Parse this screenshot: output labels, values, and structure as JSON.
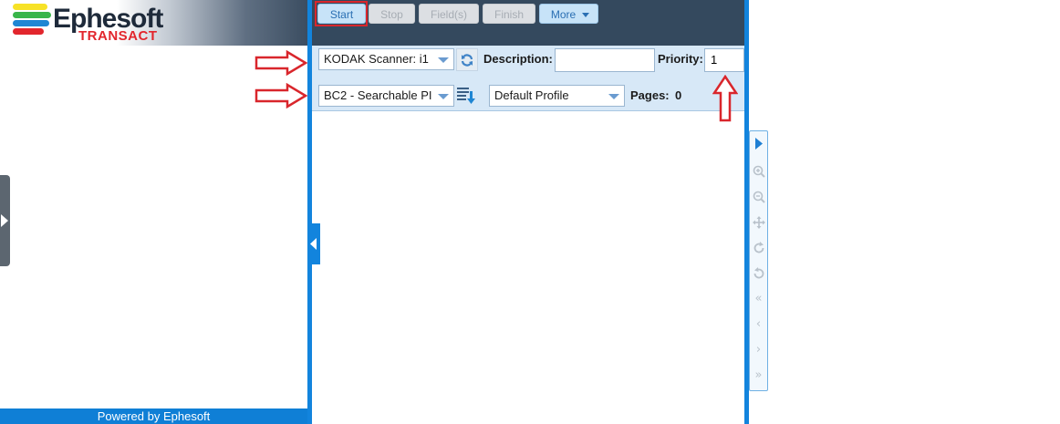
{
  "logo": {
    "name": "Ephesoft",
    "tagline": "TRANSACT"
  },
  "footer": {
    "text": "Powered by Ephesoft"
  },
  "toolbar": {
    "start": "Start",
    "stop": "Stop",
    "fields": "Field(s)",
    "finish": "Finish",
    "more": "More"
  },
  "scanner": {
    "device_value": "KODAK Scanner: i1",
    "description_label": "Description:",
    "description_value": "",
    "priority_label": "Priority:",
    "priority_value": "1",
    "batch_class_value": "BC2 - Searchable PI",
    "profile_value": "Default Profile",
    "pages_label": "Pages:",
    "pages_value": "0"
  },
  "colors": {
    "accent": "#1284dd",
    "toolbar_bg": "#34495e",
    "highlight": "#d9262c"
  }
}
